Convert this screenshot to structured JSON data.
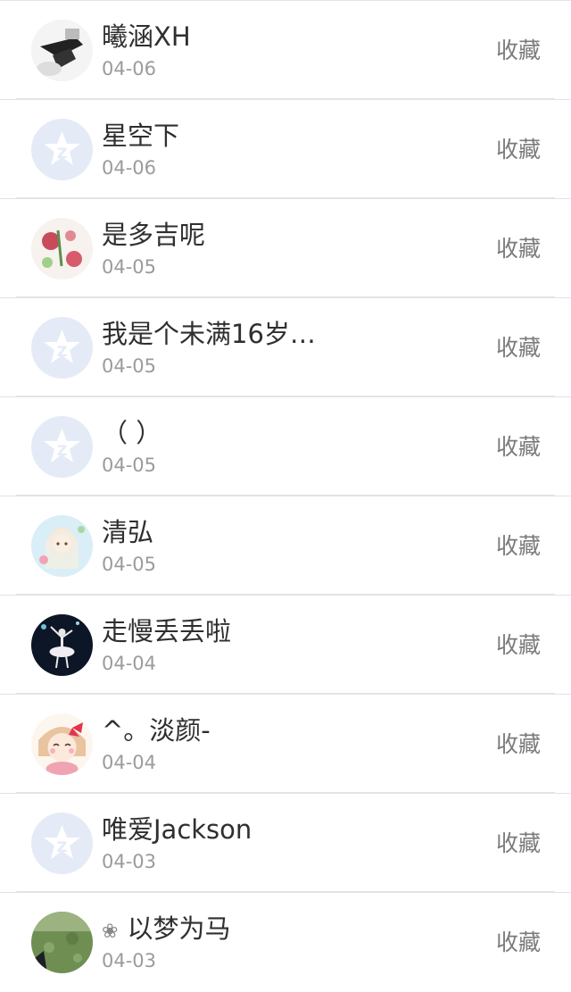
{
  "items": [
    {
      "name": "曦涵XH",
      "date": "04-06",
      "action": "收藏",
      "avatar": "photo-legs-icon"
    },
    {
      "name": "星空下",
      "date": "04-06",
      "action": "收藏",
      "avatar": "default-qzone-avatar-icon"
    },
    {
      "name": "是多吉呢",
      "date": "04-05",
      "action": "收藏",
      "avatar": "floral-illustration-icon"
    },
    {
      "name": "我是个未满16岁…",
      "date": "04-05",
      "action": "收藏",
      "avatar": "default-qzone-avatar-icon"
    },
    {
      "name": "（ ）",
      "date": "04-05",
      "action": "收藏",
      "avatar": "default-qzone-avatar-icon"
    },
    {
      "name": "清弘",
      "date": "04-05",
      "action": "收藏",
      "avatar": "anime-girl-icon"
    },
    {
      "name": "走慢丢丢啦",
      "date": "04-04",
      "action": "收藏",
      "avatar": "ballerina-dark-icon"
    },
    {
      "name": "^。淡颜-",
      "date": "04-04",
      "action": "收藏",
      "avatar": "cartoon-girl-bow-icon"
    },
    {
      "name": "唯爱Jackson",
      "date": "04-03",
      "action": "收藏",
      "avatar": "default-qzone-avatar-icon"
    },
    {
      "name": "以梦为马",
      "name_prefix": "❀",
      "date": "04-03",
      "action": "收藏",
      "avatar": "green-field-photo-icon"
    }
  ],
  "colors": {
    "name_text": "#2f2f2f",
    "date_text": "#9b9b9b",
    "action_text": "#7b7b7b",
    "divider": "#e3e3e6",
    "default_avatar_bg": "#e4ebf7"
  }
}
